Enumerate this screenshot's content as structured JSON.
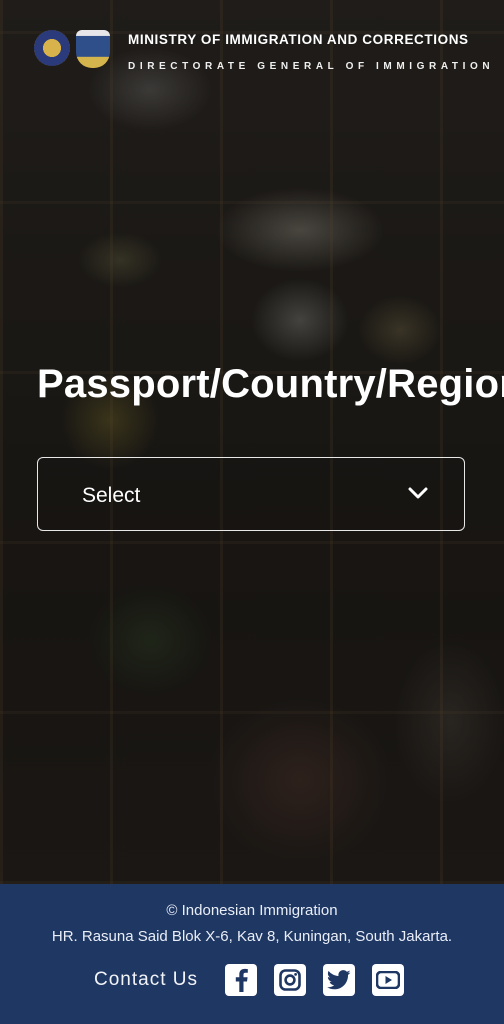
{
  "header": {
    "ministry": "MINISTRY OF IMMIGRATION AND CORRECTIONS",
    "directorate": "DIRECTORATE GENERAL OF IMMIGRATION"
  },
  "main": {
    "title": "Passport/Country/Region",
    "select": {
      "selected_value": "Select",
      "icon": "chevron-down-icon"
    }
  },
  "footer": {
    "copyright": "© Indonesian Immigration",
    "address": "HR. Rasuna Said Blok X-6, Kav 8, Kuningan, South Jakarta.",
    "contact_label": "Contact Us",
    "social_icons": [
      "facebook-icon",
      "instagram-icon",
      "twitter-icon",
      "youtube-icon"
    ],
    "background_color": "#1f3763"
  }
}
